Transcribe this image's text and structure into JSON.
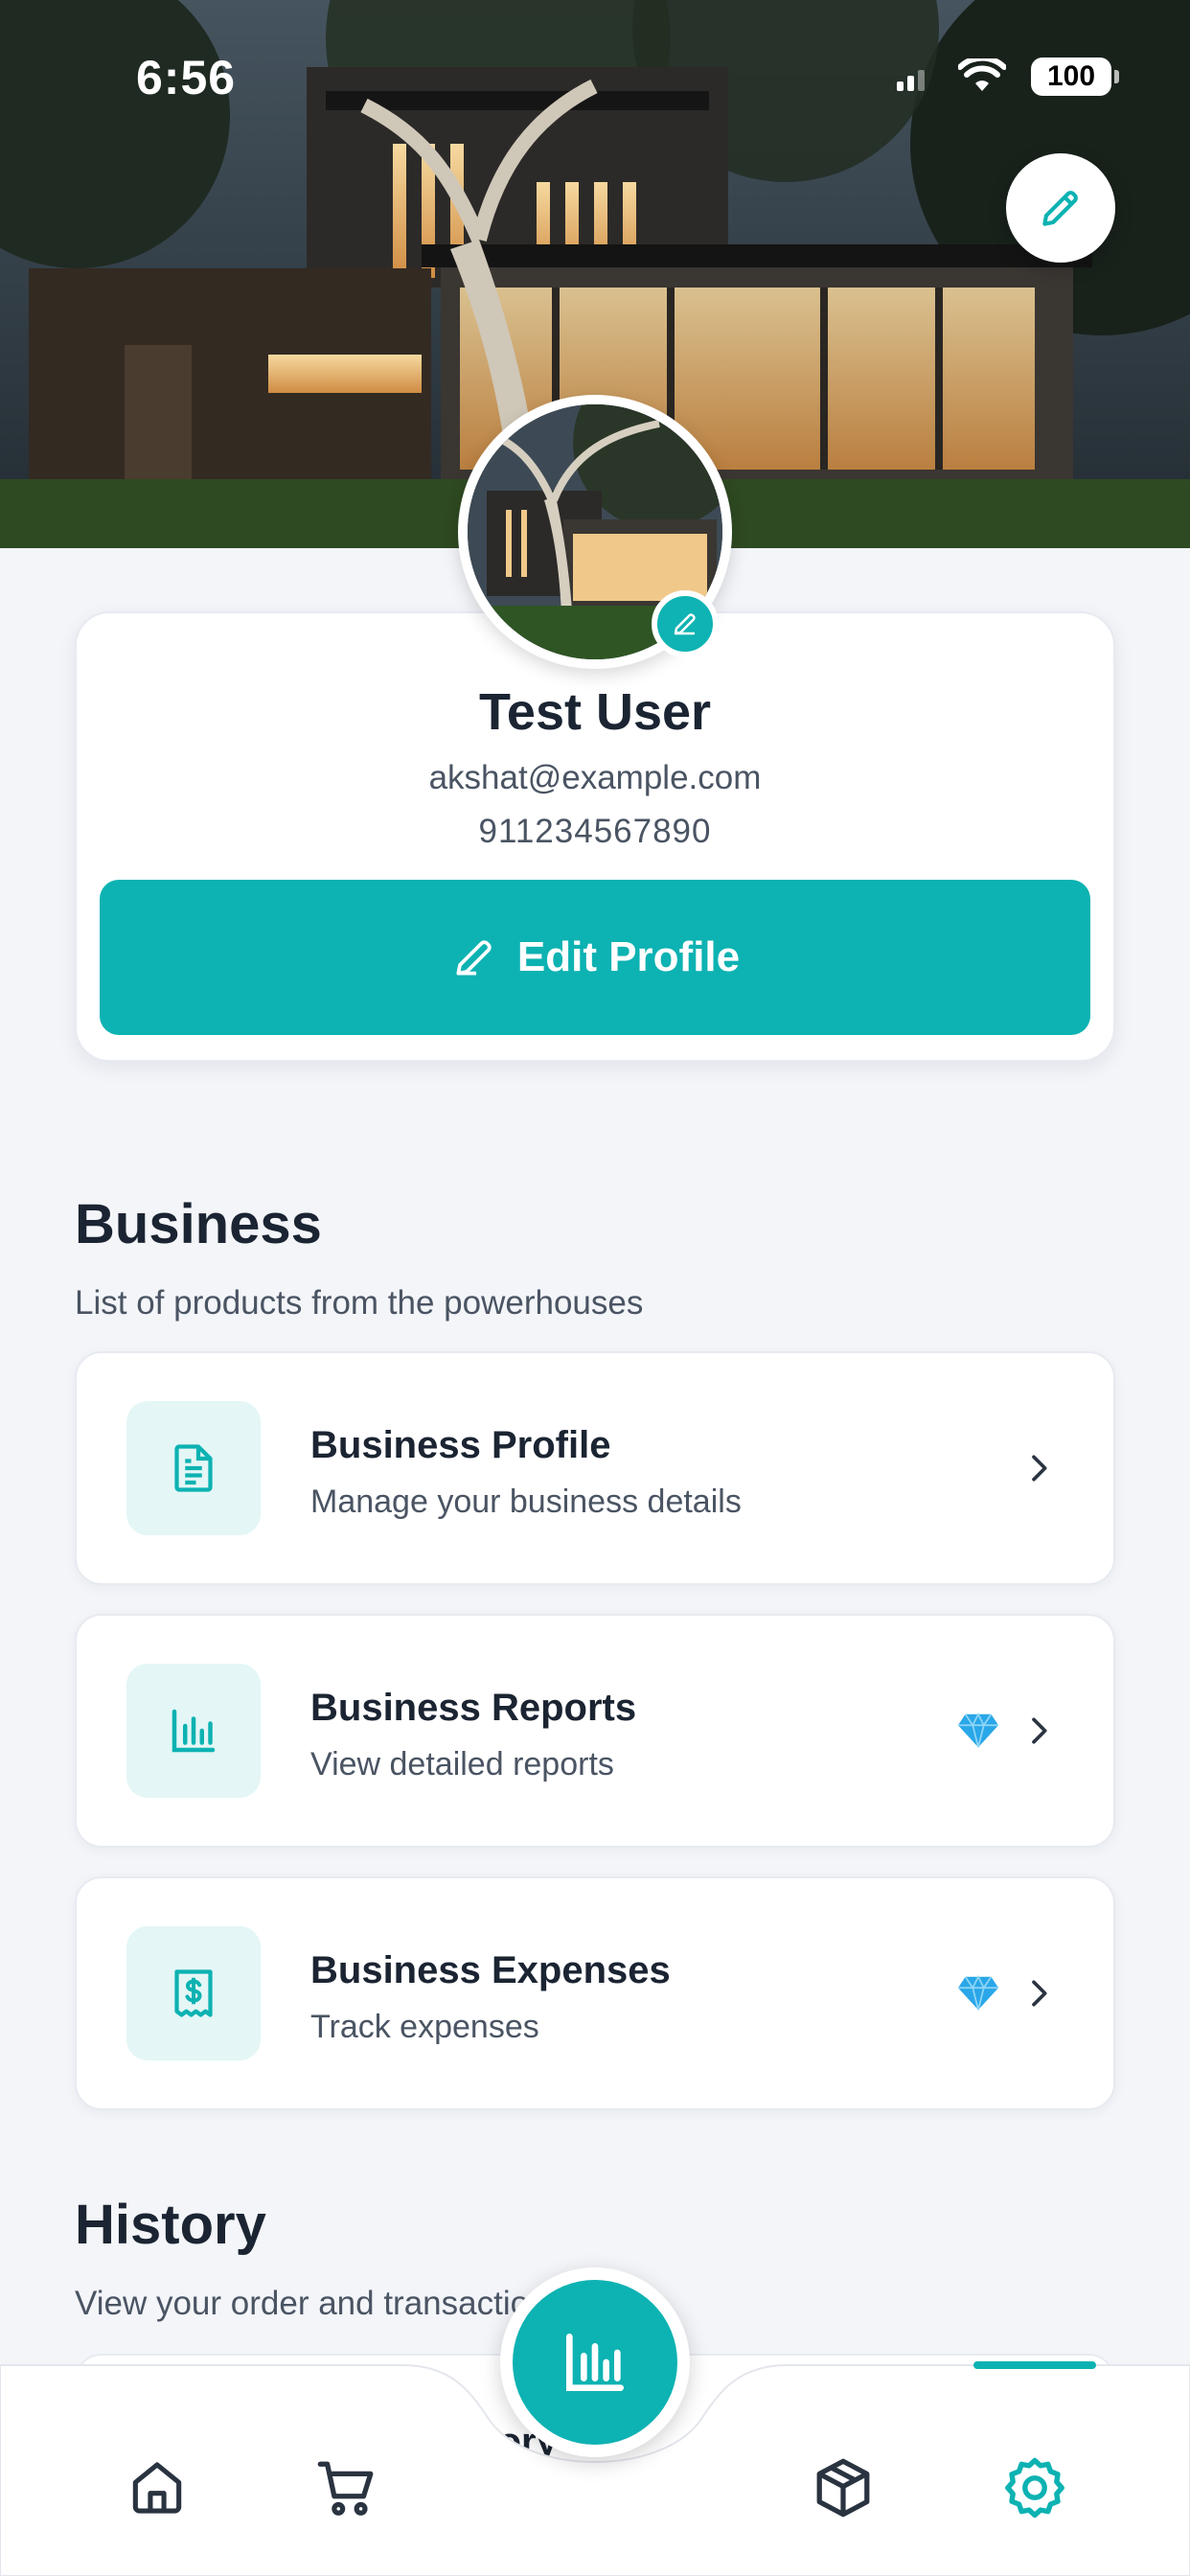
{
  "status_bar": {
    "time": "6:56",
    "battery": "100"
  },
  "profile": {
    "name": "Test User",
    "email": "akshat@example.com",
    "phone": "911234567890",
    "edit_button_label": "Edit Profile"
  },
  "business": {
    "title": "Business",
    "subtitle": "List of products from the powerhouses",
    "items": [
      {
        "title": "Business Profile",
        "subtitle": "Manage your business details",
        "icon": "document-icon",
        "premium": false
      },
      {
        "title": "Business Reports",
        "subtitle": "View detailed reports",
        "icon": "bar-chart-icon",
        "premium": true
      },
      {
        "title": "Business Expenses",
        "subtitle": "Track expenses",
        "icon": "receipt-dollar-icon",
        "premium": true
      }
    ]
  },
  "history": {
    "title": "History",
    "subtitle": "View your order and transaction history",
    "peek_item_title": "Order History"
  },
  "bottom_nav": {
    "items": [
      "home-icon",
      "cart-icon",
      "box-icon",
      "settings-icon"
    ],
    "active": "settings-icon",
    "fab_icon": "bar-chart-icon"
  },
  "colors": {
    "accent": "#0db2b2",
    "accent_light": "#e4f6f6",
    "background": "#f3f5f9",
    "gem": "#2aa7e8"
  }
}
